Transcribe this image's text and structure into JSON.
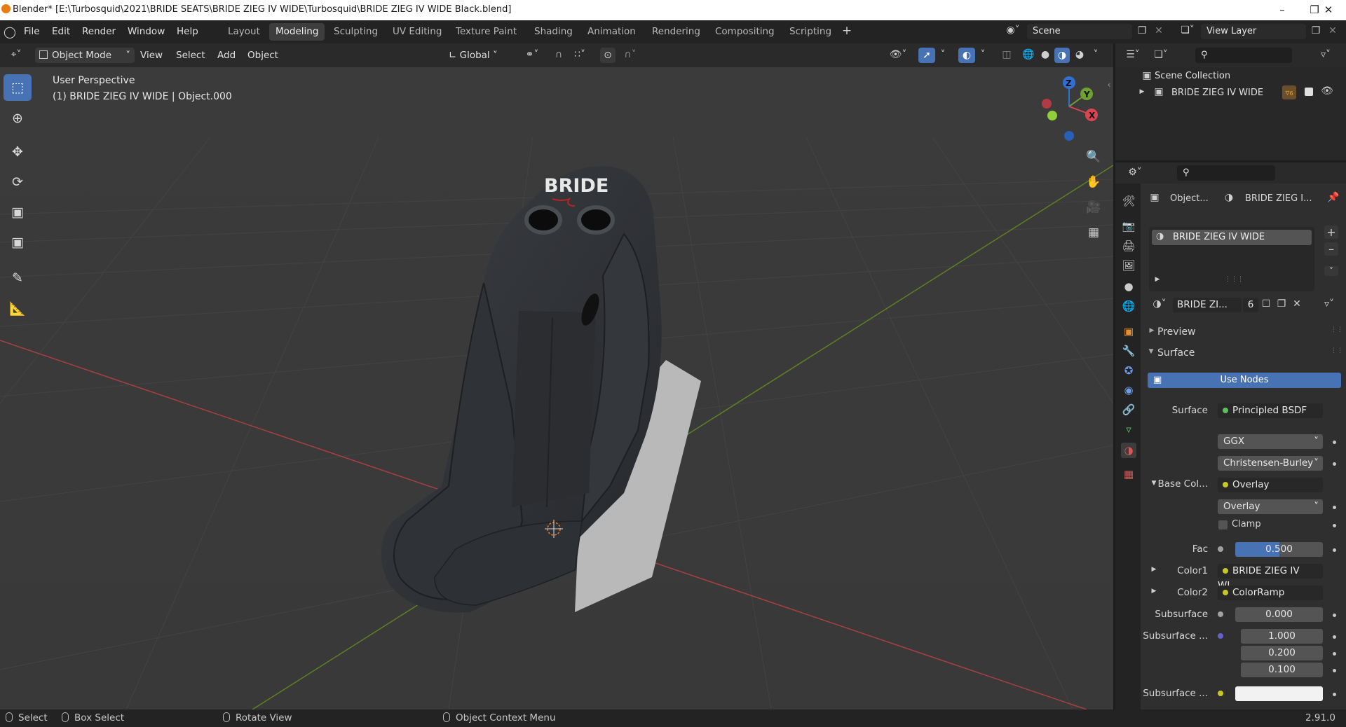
{
  "window": {
    "title": "Blender* [E:\\Turbosquid\\2021\\BRIDE SEATS\\BRIDE ZIEG IV WIDE\\Turbosquid\\BRIDE ZIEG IV WIDE Black.blend]"
  },
  "menus": [
    "File",
    "Edit",
    "Render",
    "Window",
    "Help"
  ],
  "workspaces": [
    "Layout",
    "Modeling",
    "Sculpting",
    "UV Editing",
    "Texture Paint",
    "Shading",
    "Animation",
    "Rendering",
    "Compositing",
    "Scripting"
  ],
  "active_workspace": "Modeling",
  "scene": {
    "label": "Scene",
    "view_layer": "View Layer"
  },
  "viewport_header": {
    "mode": "Object Mode",
    "menus": [
      "View",
      "Select",
      "Add",
      "Object"
    ],
    "orientation": "Global"
  },
  "viewport": {
    "perspective": "User Perspective",
    "object_info": "(1) BRIDE ZIEG IV WIDE | Object.000",
    "seat_logo": "BRIDE",
    "gizmo": {
      "z": "Z",
      "y": "Y",
      "x": "X"
    }
  },
  "outliner": {
    "scene_collection": "Scene Collection",
    "items": [
      {
        "name": "BRIDE ZIEG IV WIDE",
        "badge": "6"
      }
    ]
  },
  "properties": {
    "breadcrumb_object": "Object...",
    "breadcrumb_material": "BRIDE ZIEG I...",
    "material_slot": "BRIDE ZIEG IV WIDE",
    "material_name": "BRIDE ZI...",
    "user_count": "6",
    "panels": {
      "preview": "Preview",
      "surface": "Surface"
    },
    "use_nodes": "Use Nodes",
    "rows": {
      "surface_label": "Surface",
      "surface_value": "Principled BSDF",
      "distribution": "GGX",
      "subsurface_method": "Christensen-Burley",
      "base_color_label": "Base Col...",
      "base_color_value": "Overlay",
      "blend_mode": "Overlay",
      "clamp": "Clamp",
      "fac_label": "Fac",
      "fac_value": "0.500",
      "fac_fraction": 0.5,
      "color1_label": "Color1",
      "color1_value": "BRIDE ZIEG IV WI...",
      "color2_label": "Color2",
      "color2_value": "ColorRamp",
      "subsurface_label": "Subsurface",
      "subsurface_value": "0.000",
      "subsurface_radius_label": "Subsurface ...",
      "subsurface_radius": [
        "1.000",
        "0.200",
        "0.100"
      ],
      "subsurface_color_label": "Subsurface ..."
    }
  },
  "statusbar": {
    "select": "Select",
    "box_select": "Box Select",
    "rotate": "Rotate View",
    "context": "Object Context Menu",
    "version": "2.91.0"
  },
  "colors": {
    "accent": "#4772b3",
    "socket_yellow": "#c7c729",
    "socket_gray": "#a1a1a1",
    "socket_blue": "#6363c7",
    "axis_x": "#c04448",
    "axis_y": "#6a8e23"
  }
}
